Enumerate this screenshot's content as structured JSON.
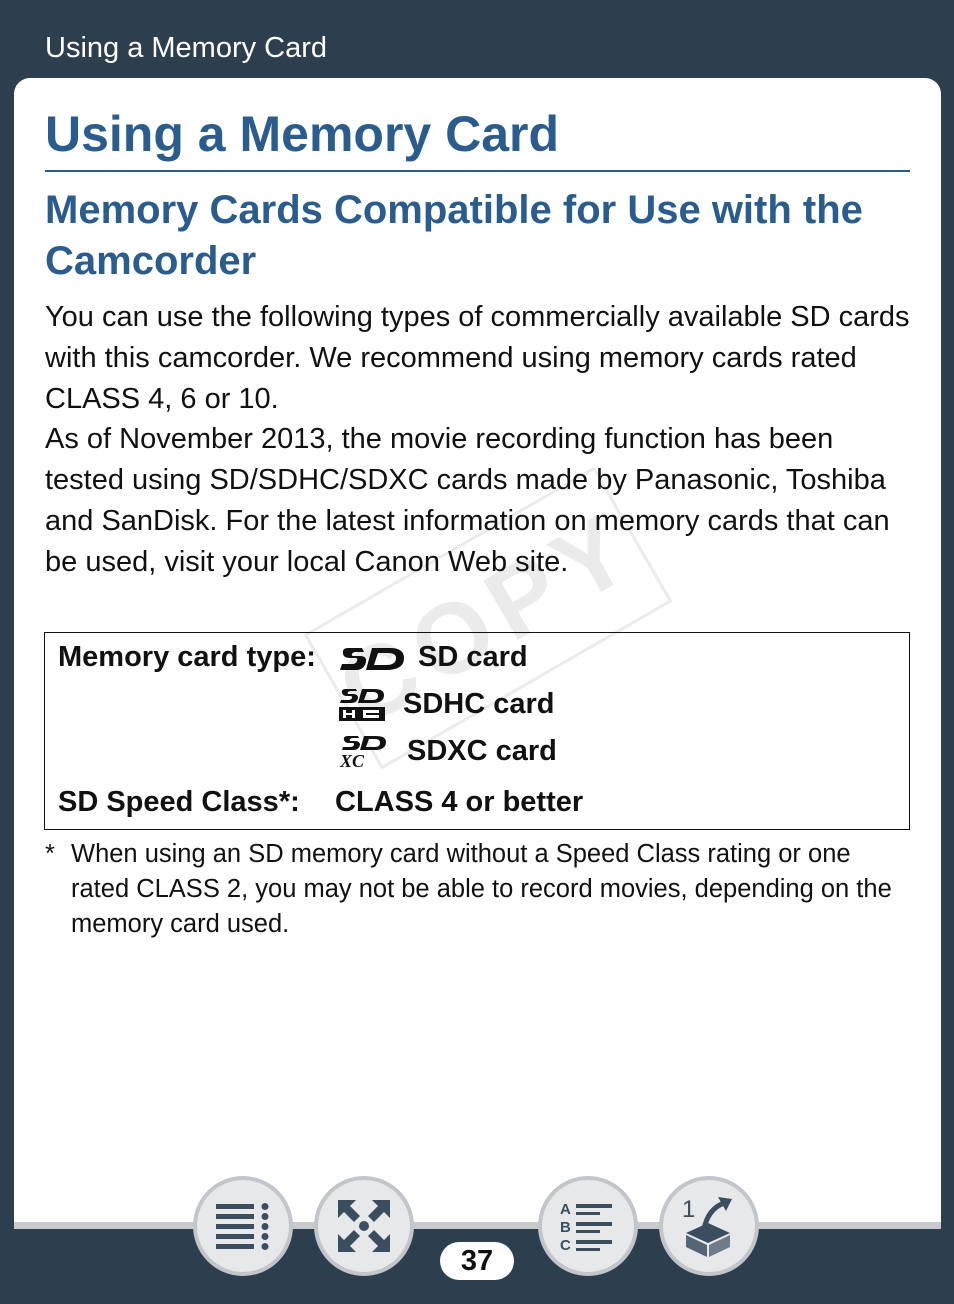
{
  "header": {
    "title": "Using a Memory Card"
  },
  "page": {
    "title": "Using a Memory Card",
    "section_title": "Memory Cards Compatible for Use with the Camcorder",
    "paragraphs": [
      "You can use the following types of commercially available SD cards with this camcorder. We recommend using memory cards rated CLASS 4, 6 or 10.",
      "As of November 2013, the movie recording function has been tested using SD/SDHC/SDXC cards made by Panasonic, Toshiba and SanDisk. For the latest information on memory cards that can be used, visit your local Canon Web site."
    ],
    "spec_box": {
      "card_type_label": "Memory card type:",
      "card_types": [
        "SD card",
        "SDHC card",
        "SDXC card"
      ],
      "speed_label": "SD Speed Class*:",
      "speed_value": "CLASS 4 or better"
    },
    "footnote": {
      "mark": "*",
      "text": "When using an SD memory card without a Speed Class rating or one rated CLASS 2, you may not be able to record movies, depending on the memory card used."
    },
    "watermark": "COPY"
  },
  "footer": {
    "page_number": "37",
    "buttons": [
      "table-of-contents",
      "fullscreen",
      "index",
      "back"
    ]
  },
  "colors": {
    "frame": "#2d3e4e",
    "heading": "#2a5d8e",
    "button_face": "#e6e8ea",
    "button_icon": "#3a4e60"
  }
}
